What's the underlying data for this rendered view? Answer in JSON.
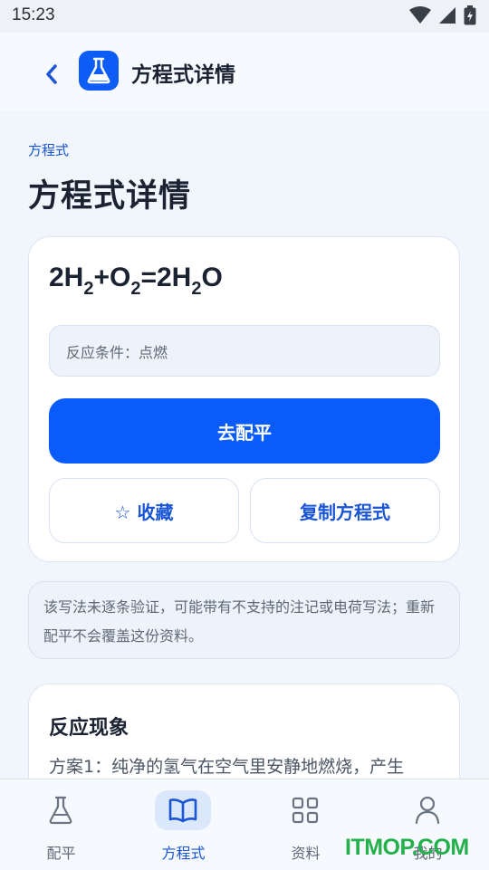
{
  "status_bar": {
    "time": "15:23"
  },
  "app_bar": {
    "title": "方程式详情",
    "back_icon": "chevron-left-icon",
    "app_icon": "flask-icon"
  },
  "breadcrumb": "方程式",
  "page_title": "方程式详情",
  "equation": {
    "parts": [
      {
        "text": "2H"
      },
      {
        "sub": "2"
      },
      {
        "text": "+O"
      },
      {
        "sub": "2"
      },
      {
        "text": "=2H"
      },
      {
        "sub": "2"
      },
      {
        "text": "O"
      }
    ]
  },
  "conditions": "反应条件：点燃",
  "buttons": {
    "balance": "去配平",
    "favorite": "☆ 收藏",
    "copy": "复制方程式"
  },
  "notice": "该写法未逐条验证，可能带有不支持的注记或电荷写法；重新配平不会覆盖这份资料。",
  "phenomenon": {
    "title": "反应现象",
    "text": "方案1：纯净的氢气在空气里安静地燃烧，产生"
  },
  "bottom_nav": [
    {
      "label": "配平",
      "icon": "flask-icon",
      "active": false
    },
    {
      "label": "方程式",
      "icon": "book-icon",
      "active": true
    },
    {
      "label": "资料",
      "icon": "grid-icon",
      "active": false
    },
    {
      "label": "我的",
      "icon": "user-icon",
      "active": false
    }
  ],
  "watermark": "ITMOP.COM",
  "colors": {
    "accent": "#0a5cfa",
    "link": "#1a55d6",
    "background": "#f1f5fc"
  }
}
